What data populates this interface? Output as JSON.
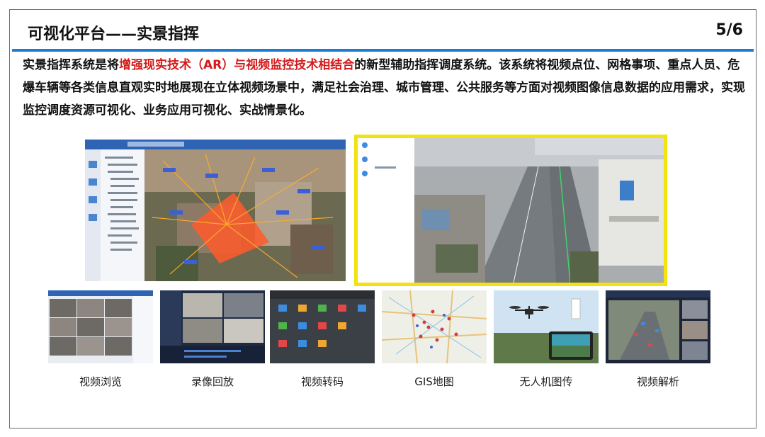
{
  "header": {
    "title": "可视化平台——实景指挥",
    "page": "5/6"
  },
  "intro": {
    "part1": "实景指挥系统是将",
    "highlight": "增强现实技术（AR）与视频监控技术相结合",
    "part2": "的新型辅助指挥调度系统。该系统将视频点位、网格事项、重点人员、危爆车辆等各类信息直观实时地展现在立体视频场景中，满足社会治理、城市管理、公共服务等方面对视频图像信息数据的应用需求，实现监控调度资源可视化、业务应用可视化、实战情景化。"
  },
  "colors": {
    "accent_rule": "#1a7fd4",
    "highlight_text": "#d41a1a",
    "selection_frame": "#f2e20e"
  },
  "features": [
    {
      "label": "视频浏览"
    },
    {
      "label": "录像回放"
    },
    {
      "label": "视频转码"
    },
    {
      "label": "GIS地图"
    },
    {
      "label": "无人机图传"
    },
    {
      "label": "视频解析"
    }
  ]
}
